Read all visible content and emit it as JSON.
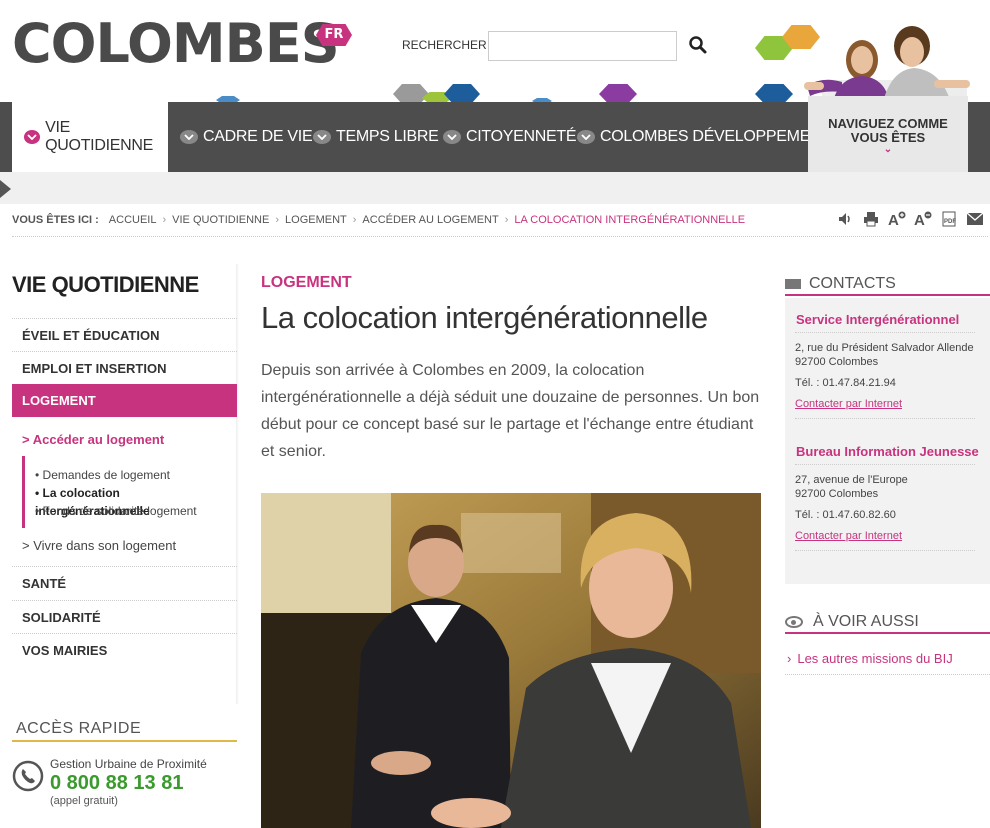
{
  "header": {
    "logo_text": "COLOMBES",
    "logo_badge": "FR",
    "search_label": "RECHERCHER :",
    "search_value": "",
    "navigate_box": {
      "line1": "NAVIGUEZ COMME",
      "line2": "VOUS ÊTES"
    }
  },
  "nav": {
    "items": [
      {
        "label": "VIE QUOTIDIENNE",
        "active": true
      },
      {
        "label": "CADRE DE VIE",
        "active": false
      },
      {
        "label": "TEMPS LIBRE",
        "active": false
      },
      {
        "label": "CITOYENNETÉ",
        "active": false
      },
      {
        "label": "COLOMBES DÉVELOPPEMENT",
        "active": false
      }
    ]
  },
  "breadcrumb": {
    "label": "VOUS ÊTES ICI :",
    "items": [
      "ACCUEIL",
      "VIE QUOTIDIENNE",
      "LOGEMENT",
      "ACCÉDER AU LOGEMENT"
    ],
    "current": "LA COLOCATION INTERGÉNÉRATIONNELLE"
  },
  "tools": [
    "speaker-icon",
    "print-icon",
    "text-larger-icon",
    "text-smaller-icon",
    "pdf-icon",
    "email-icon"
  ],
  "sidebar": {
    "title": "VIE QUOTIDIENNE",
    "items": [
      "ÉVEIL ET ÉDUCATION",
      "EMPLOI ET INSERTION",
      "LOGEMENT"
    ],
    "sub_heading": "> Accéder au logement",
    "sub_items": [
      "• Demandes de logement",
      "• La colocation intergénérationnelle",
      "• Fonds de solidarité logement"
    ],
    "vivre": "> Vivre dans son logement",
    "items_after": [
      "SANTÉ",
      "SOLIDARITÉ",
      "VOS MAIRIES"
    ],
    "access_title": "ACCÈS RAPIDE",
    "access_label": "Gestion Urbaine de Proximité",
    "access_phone": "0 800 88 13 81",
    "access_note": "(appel gratuit)"
  },
  "main": {
    "category": "LOGEMENT",
    "title": "La colocation intergénérationnelle",
    "intro": "Depuis son arrivée à Colombes en 2009, la colocation intergénérationnelle a déjà séduit une douzaine de personnes. Un bon début pour ce concept basé sur le partage et l'échange entre étudiant et senior."
  },
  "contacts": {
    "heading": "CONTACTS",
    "entries": [
      {
        "name": "Service Intergénérationnel",
        "addr1": "2, rue du Président Salvador Allende",
        "addr2": "92700 Colombes",
        "tel": "Tél. : 01.47.84.21.94",
        "link": "Contacter par Internet"
      },
      {
        "name": "Bureau Information Jeunesse",
        "addr1": "27, avenue de l'Europe",
        "addr2": "92700 Colombes",
        "tel": "Tél. : 01.47.60.82.60",
        "link": "Contacter par Internet"
      }
    ]
  },
  "see_also": {
    "heading": "À VOIR AUSSI",
    "items": [
      "Les autres missions du BIJ"
    ]
  },
  "colors": {
    "accent": "#c8337f",
    "nav_bg": "#4d4d4d",
    "phone_green": "#3b9a2e"
  }
}
